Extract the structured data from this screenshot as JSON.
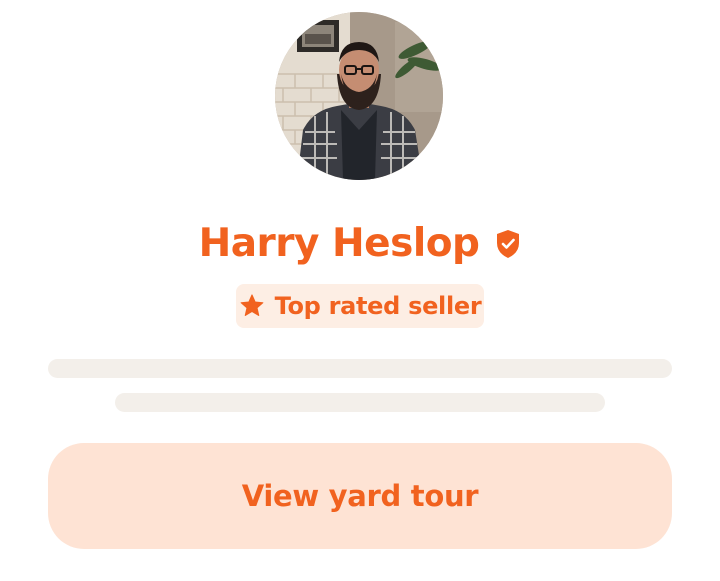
{
  "profile": {
    "name": "Harry Heslop",
    "avatar_icon": "person-photo",
    "verified_icon": "shield-check-icon"
  },
  "badge": {
    "icon": "star-icon",
    "label": "Top rated seller"
  },
  "cta": {
    "label": "View yard tour"
  },
  "colors": {
    "accent": "#f1621f",
    "badge_bg": "#fdeee4",
    "cta_bg": "#fee3d4",
    "skeleton": "#f3efea"
  }
}
